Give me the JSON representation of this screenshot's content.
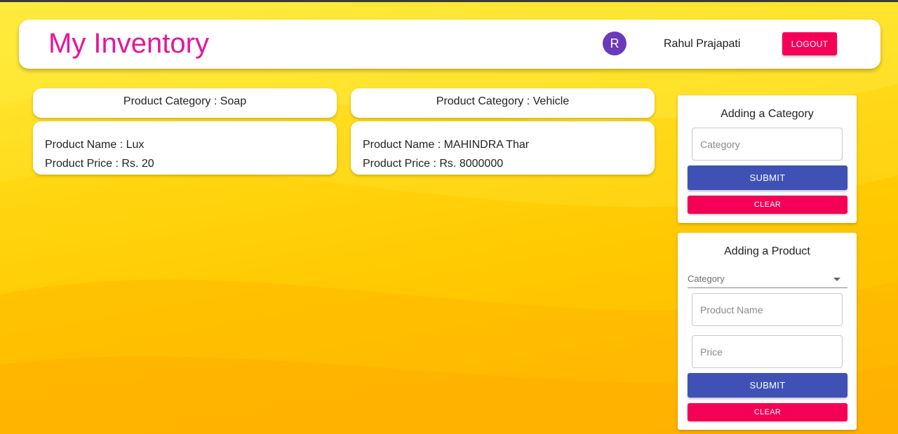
{
  "header": {
    "title": "My Inventory",
    "user_initial": "R",
    "user_name": "Rahul Prajapati",
    "logout_label": "LOGOUT"
  },
  "categories": [
    {
      "header": "Product Category : Soap",
      "products": [
        {
          "name": "Product Name : Lux",
          "price": "Product Price : Rs. 20"
        }
      ]
    },
    {
      "header": "Product Category : Vehicle",
      "products": [
        {
          "name": "Product Name : MAHINDRA Thar",
          "price": "Product Price : Rs. 8000000"
        }
      ]
    }
  ],
  "add_category": {
    "title": "Adding a Category",
    "category_placeholder": "Category",
    "submit_label": "SUBMIT",
    "clear_label": "CLEAR"
  },
  "add_product": {
    "title": "Adding a Product",
    "category_select_label": "Category",
    "product_name_placeholder": "Product Name",
    "price_placeholder": "Price",
    "submit_label": "SUBMIT",
    "clear_label": "CLEAR"
  },
  "colors": {
    "title_magenta": "#e6169b",
    "avatar_purple": "#6a3ab9",
    "primary_blue": "#3f51b5",
    "secondary_pink": "#f50057",
    "background_yellow": "#ffd000"
  }
}
